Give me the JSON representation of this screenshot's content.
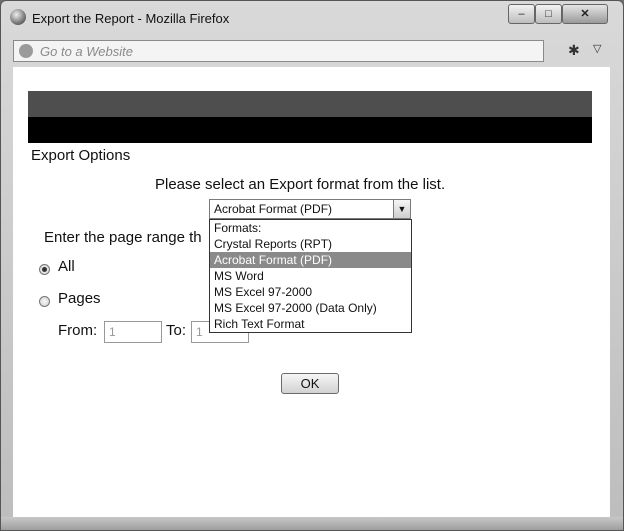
{
  "window": {
    "title": "Export the Report - Mozilla Firefox",
    "minimize_glyph": "–",
    "maximize_glyph": "□",
    "close_glyph": "✕"
  },
  "toolbar": {
    "url_placeholder": "Go to a Website"
  },
  "export": {
    "section_title": "Export Options",
    "instruction": "Please select an Export format from the list.",
    "selected_format": "Acrobat Format (PDF)",
    "options": [
      "Formats:",
      "Crystal Reports (RPT)",
      "Acrobat Format (PDF)",
      "MS Word",
      "MS Excel 97-2000",
      "MS Excel 97-2000 (Data Only)",
      "Rich Text Format"
    ],
    "highlighted_option": "Acrobat Format (PDF)",
    "page_range_label": "Enter the page range th",
    "radio_all": "All",
    "radio_pages": "Pages",
    "radio_selected": "All",
    "from_label": "From:",
    "from_value": "1",
    "to_label": "To:",
    "to_value": "1",
    "ok_label": "OK"
  },
  "icons": {
    "app": "firefox-icon",
    "url": "globe-icon",
    "tool": "bug-icon",
    "menu": "chevron-down-icon"
  },
  "colors": {
    "header_band_top": "#4e4e4e",
    "header_band_bottom": "#000000",
    "highlight": "#8a8a8a"
  }
}
